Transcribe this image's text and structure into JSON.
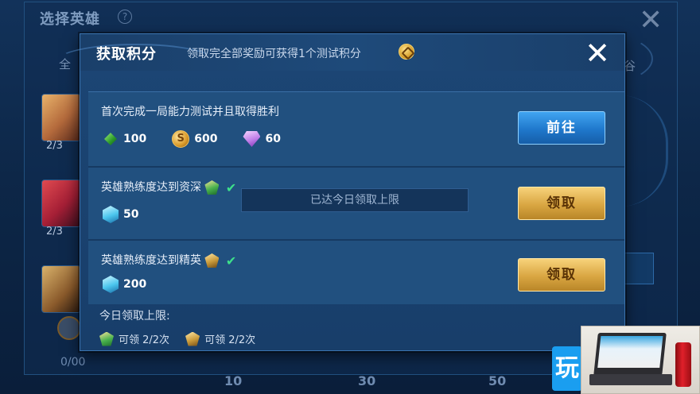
{
  "background": {
    "title": "选择英雄",
    "help_glyph": "?",
    "close_glyph": "✕",
    "tab_left": "全",
    "tab_right": "谷",
    "portrait_counts": [
      "2/3",
      "2/3"
    ],
    "bottom_left": "0/00",
    "progress_marks": [
      "10",
      "30",
      "50"
    ]
  },
  "modal": {
    "title": "获取积分",
    "subtitle": "领取完全部奖励可获得1个测试积分",
    "close_glyph": "✕",
    "tasks": [
      {
        "title": "首次完成一局能力测试并且取得胜利",
        "rewards": [
          {
            "icon": "emerald-icon",
            "value": "100"
          },
          {
            "icon": "gold-coin-icon",
            "value": "600"
          },
          {
            "icon": "diamond-icon",
            "value": "60"
          }
        ],
        "button": "前往",
        "button_style": "blue"
      },
      {
        "title": "英雄熟练度达到资深",
        "badge": "green-badge-icon",
        "completed": true,
        "rewards": [
          {
            "icon": "crystal-icon",
            "value": "50"
          }
        ],
        "button": "领取",
        "button_style": "gold"
      },
      {
        "title": "英雄熟练度达到精英",
        "badge": "gold-badge-icon",
        "completed": true,
        "rewards": [
          {
            "icon": "crystal-icon",
            "value": "200"
          }
        ],
        "button": "领取",
        "button_style": "gold"
      }
    ],
    "toast": "已达今日领取上限",
    "footer": {
      "label": "今日领取上限:",
      "items": [
        {
          "icon": "green-badge-icon",
          "text": "可领 2/2次"
        },
        {
          "icon": "gold-badge-icon",
          "text": "可领 2/2次"
        }
      ]
    }
  },
  "colors": {
    "button_blue": "#1f78cc",
    "button_gold": "#d9a642",
    "check_green": "#3de08a"
  },
  "watermark": {
    "glyph": "玩"
  }
}
